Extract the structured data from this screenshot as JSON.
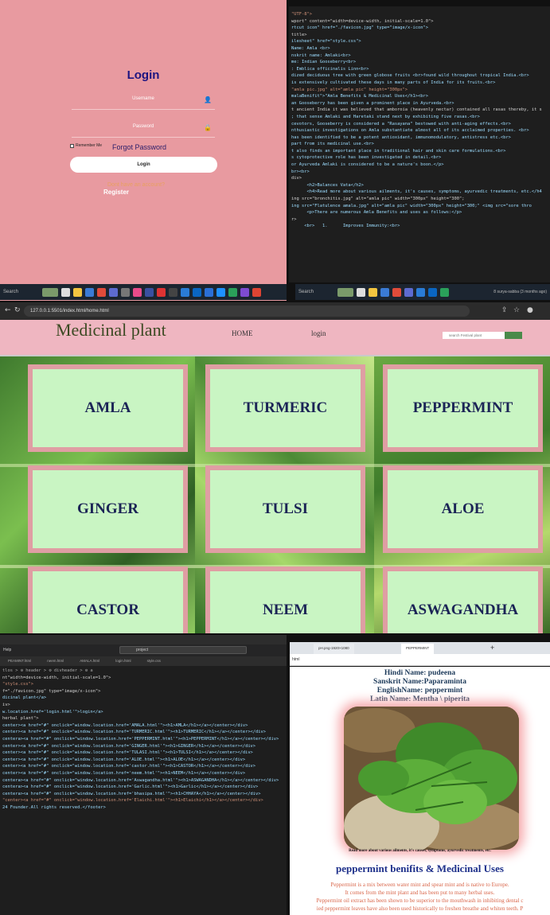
{
  "login": {
    "title": "Login",
    "username_placeholder": "Username",
    "password_placeholder": "Password",
    "remember_label": "Remember Me",
    "forgot_label": "Forgot Password",
    "button_label": "Login",
    "no_account_text": "Dont have an account?",
    "register_label": "Register"
  },
  "taskbar_left": {
    "search_label": "Search"
  },
  "taskbar_right": {
    "search_label": "Search",
    "status_text": "8 surya-sabba (3 months ago)"
  },
  "code_top_right": [
    "\"UTF-8\">",
    "wport\" content=\"width=device-width, initial-scale=1.0\">",
    "rtcut icon\" href=\"./favicon.jpg\" type=\"image/x-icon\">",
    "title>",
    "ilesheet\" href=\"style.css\">",
    "",
    "",
    "Name: Amla <br>",
    "nskrit name: Amlaki<br>",
    "me: Indian Gooseberry<br>",
    ": Emblica officinalis Linn<br>",
    "dized deciduous tree with green globose fruits <br>found wild throughout tropical India.<br>",
    "is extensively cultivated these days in many parts of India for its fruits.<br>",
    "",
    "",
    "\"amla pic.jpg\" alt=\"amla pic\" height=\"300px\">",
    "",
    "",
    "malaBenifit\">\"Amla Benefits & Medicinal Uses</h1><br>",
    "an Gooseberry has been given a prominent place in Ayurveda.<br>",
    "t ancient India it was believed that amboroia (heavenly nectar) contained all rasas thereby, it s",
    "; that sense Amlaki and Haretaki stand next by exhibiting five rasas.<br>",
    "cevotors, Gooseberry is considered a \"Rasayana\" bestowed with anti-aging effects.<br>",
    "nthusiastic investigations on Amla substantiate almost all of its acclaimed properties. <br>",
    "has been identified to be a potent antioxidant, immunomodulatory, antistress etc.<br>",
    "part from its medicinal use.<br>",
    "t also finds an important place in traditional hair and skin care formulations.<br>",
    "s cytoprotective role has been investigated in detail.<br>",
    "or Ayurveda Amlaki is considered to be a nature's boon.</p>",
    "br><br>",
    "div>",
    "      <h2>Balances Vata</h2>",
    "      <h4>Read more about various ailments, it's causes, symptoms, ayurvedic treatments, etc.</h4",
    "ing src=\"bronchitis.jpg\" alt=\"amla pic\" width=\"300px\" height=\"300\";",
    "ing src=\"Flatulence amala.jpg\" alt=\"amla pic\" width=\"300px\" height=\"300;\" <img src=\"sore thro",
    "",
    "      <p>There are numerous Amla Benefits and uses as follows:</p>",
    "r>",
    "",
    "     <br>   1.      Improves Immunity:<br>"
  ],
  "browser": {
    "url": "127.0.0.1:5501/index.html/home.html"
  },
  "site": {
    "title": "Medicinal plant",
    "nav_home": "HOME",
    "nav_login": "login",
    "search_placeholder": "search Festival plant"
  },
  "plants": [
    "AMLA",
    "TURMERIC",
    "PEPPERMINT",
    "GINGER",
    "TULSI",
    "ALOE",
    "CASTOR",
    "NEEM",
    "ASWAGANDHA"
  ],
  "vscode": {
    "menu_help": "Help",
    "search_text": "project",
    "tabs": [
      "PEAMINT.html",
      "neem.html",
      "AMALA.html",
      "login.html",
      "style.css"
    ],
    "breadcrumb": "tlos > ⚙ header > ⚙ divheader > ⚙ a"
  },
  "code_bottom_left": [
    "",
    "",
    "",
    "",
    "nt\"width=device-width, initial-scale=1.0\">",
    "",
    "\"style.css\">",
    "f=\"./favicon.jpg\" type=\"image/x-icon\">",
    "",
    "",
    "",
    "",
    "dicinal plant</a>",
    "iv>",
    "w.location.href='login.html'\">login</a>",
    "",
    "",
    "herbal plant\">",
    "",
    "",
    "",
    "",
    "",
    "center><a href=\"#\" onclick=\"window.location.href='AMALA.html'\"><h1>AMLA</h1></a></center></div>",
    "center><a href=\"#\" onclick=\"window.location.href='TURMERIC.html'\"><h1>TURMERIC</h1></a></center></div>",
    "centera><a href=\"#\" onclick=\"window.location.href='PEPPERMINT.html'\"><h1>PEPPERMINT</h1></a></center></div>",
    "center><a href=\"#\" onclick=\"window.location.href='GINGER.html'\"><h1>GINGER</h1></a></center></div>",
    "center><a href=\"#\" onclick=\"window.location.href='TULASI.html'\"><h1>TULSI</h1></a></center></div>",
    "center><a href=\"#\" onclick=\"window.location.href='ALOE.html'\"><h1>ALOE</h1></a></center></div>",
    "center><a href=\"#\" onclick=\"window.location.href='castor.html'\"><h1>CASTOR</h1></a></center></div>",
    "center><a href=\"#\" onclick=\"window.location.href='neem.html'\"><h1>NEEM</h1></a></center></div>",
    "centera><a href=\"#\" onclick=\"window.location.href='Aswagandha.html'\"><h1>ASWAGANDHA</h1></a></center></div>",
    "centera><a href=\"#\" onclick=\"window.location.href='Garlic.html'\"><h1>Garlic</h1></a></center></div>",
    "centera><a href=\"#\" onclick=\"window.location.href='bhasipa.html'\"><h1>CHHAYA</h1></a></center></div>",
    "\"center><a href=\"#\" onclick=\"window.location.href='Elaichi.html'\"><h1>Elaichi</h1></a></center></div>",
    "",
    "",
    "24 Founder.All rights reserved.</footer>"
  ],
  "peppermint": {
    "tab1": "pH.png-1920×1080",
    "tab2": "PEPPERMINT",
    "addr": "html",
    "hindi": "Hindi Name: pudeena",
    "sanskrit": "Sanskrit Name:Paparaminta",
    "english": "EnglishName: peppermint",
    "latin": "Latin Name: Mentha \\ piperita",
    "caption": "Read more about various ailments, it's causes, symptoms, ayurvedic treatments, etc.",
    "heading": "peppermint benifits & Medicinal Uses",
    "paragraphs": [
      "Peppermint is a mix between water mint and spear mint and is native to Europe.",
      "It comes from the mint plant and has been put to many herbal uses.",
      "Peppermint oil extract has been shown to be superior to the mouthwash in inhibiting dental c",
      "ied peppermint leaves have also been used historically to freshen breathe and whiten teeth. P"
    ]
  }
}
